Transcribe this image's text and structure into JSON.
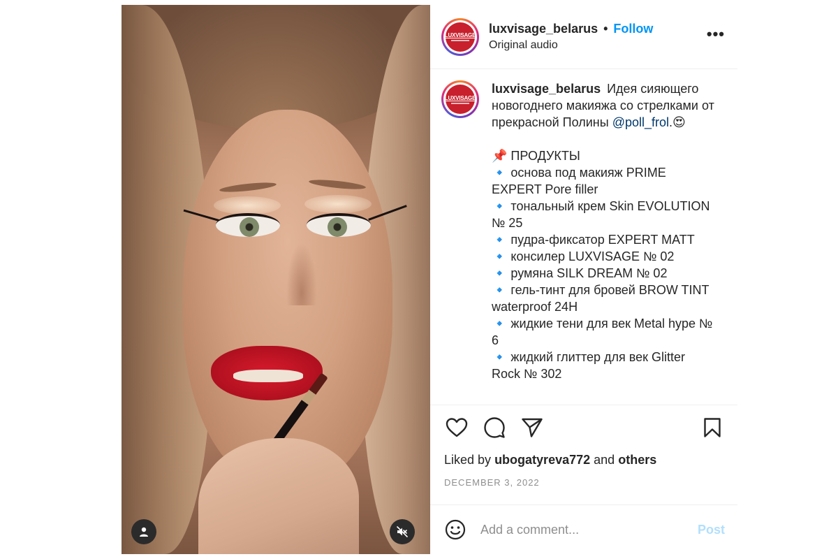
{
  "post": {
    "username": "luxvisage_belarus",
    "separator": "•",
    "follow_label": "Follow",
    "audio": "Original audio",
    "avatar_logo_text": "LUXVISAGE",
    "more_label": "•••"
  },
  "caption": {
    "username": "luxvisage_belarus",
    "intro": "Идея сияющего новогоднего макияжа со стрелками от прекрасной Полины",
    "mention": "@poll_frol",
    "intro_end": ".😍",
    "products_heading": "📌 ПРОДУКТЫ",
    "items": [
      "🔹 основа под макияж PRIME EXPERT Pore filler",
      "🔹 тональный крем Skin EVOLUTION № 25",
      "🔹 пудра-фиксатор EXPERT MATT",
      "🔹 консилер LUXVISAGE № 02",
      "🔹 румяна SILK DREAM № 02",
      "🔹 гель-тинт для бровей BROW TINT waterproof 24H",
      "🔹 жидкие тени для век Metal hype № 6",
      "🔹 жидкий глиттер для век Glitter Rock № 302"
    ]
  },
  "likes": {
    "prefix": "Liked by",
    "user": "ubogatyreva772",
    "middle": "and",
    "others": "others"
  },
  "date": "DECEMBER 3, 2022",
  "comment": {
    "placeholder": "Add a comment...",
    "post_label": "Post"
  },
  "icons": {
    "like": "heart-icon",
    "comment": "comment-icon",
    "share": "share-icon",
    "save": "bookmark-icon",
    "emoji": "emoji-icon",
    "user_tag": "user-tag-icon",
    "mute": "mute-icon"
  },
  "colors": {
    "follow": "#0095f6",
    "mention": "#00376b",
    "post_disabled": "#b2dffc",
    "date": "#8e8e8e",
    "brand_red": "#c8202c"
  }
}
